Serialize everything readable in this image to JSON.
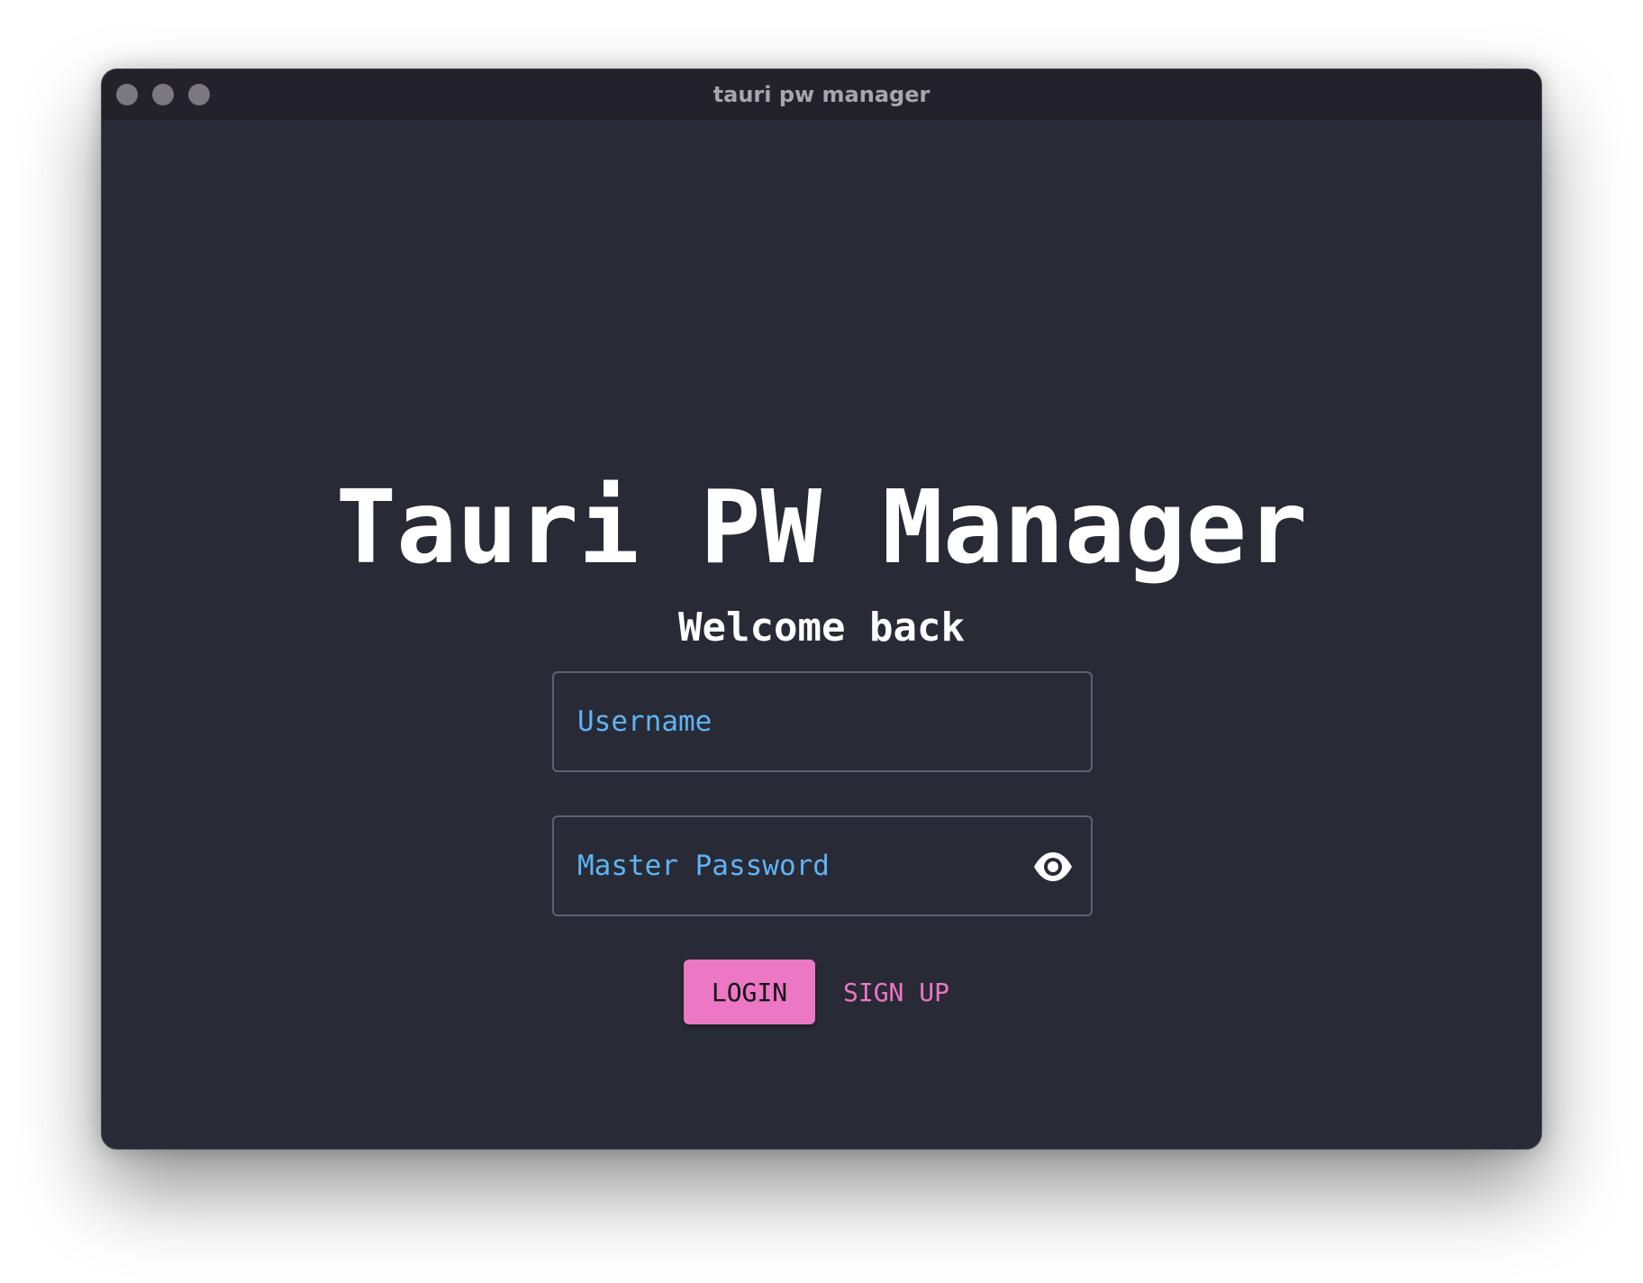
{
  "window": {
    "title": "tauri pw manager"
  },
  "app": {
    "title": "Tauri PW Manager",
    "subtitle": "Welcome back"
  },
  "form": {
    "username_placeholder": "Username",
    "username_value": "",
    "password_placeholder": "Master Password",
    "password_value": "",
    "password_visibility_icon": "eye-icon"
  },
  "actions": {
    "login_label": "LOGIN",
    "signup_label": "SIGN UP"
  },
  "colors": {
    "background": "#282a36",
    "titlebar": "#232129",
    "accent": "#ec77c4",
    "placeholder": "#5fb3f3",
    "text": "#ffffff"
  }
}
